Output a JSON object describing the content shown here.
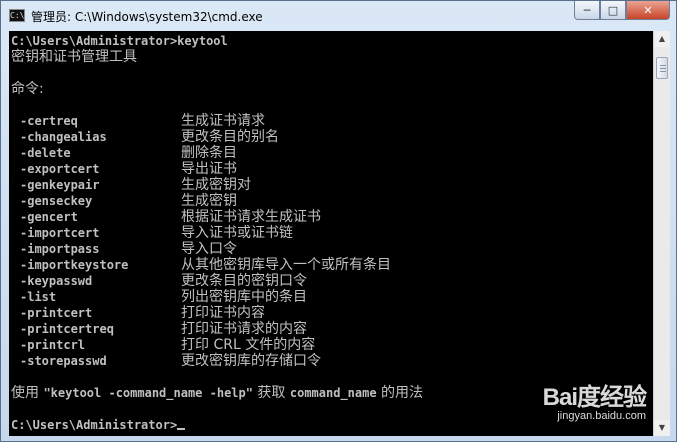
{
  "window": {
    "title": "管理员: C:\\Windows\\system32\\cmd.exe",
    "icon_glyph": "C:\\",
    "buttons": {
      "minimize": "─",
      "maximize": "□",
      "close": "✕"
    }
  },
  "console": {
    "prompt_command": "C:\\Users\\Administrator>keytool",
    "tool_description": "密钥和证书管理工具",
    "commands_header": "命令:",
    "commands": [
      {
        "name": "-certreq",
        "desc": "生成证书请求"
      },
      {
        "name": "-changealias",
        "desc": "更改条目的别名"
      },
      {
        "name": "-delete",
        "desc": "删除条目"
      },
      {
        "name": "-exportcert",
        "desc": "导出证书"
      },
      {
        "name": "-genkeypair",
        "desc": "生成密钥对"
      },
      {
        "name": "-genseckey",
        "desc": "生成密钥"
      },
      {
        "name": "-gencert",
        "desc": "根据证书请求生成证书"
      },
      {
        "name": "-importcert",
        "desc": "导入证书或证书链"
      },
      {
        "name": "-importpass",
        "desc": "导入口令"
      },
      {
        "name": "-importkeystore",
        "desc": "从其他密钥库导入一个或所有条目"
      },
      {
        "name": "-keypasswd",
        "desc": "更改条目的密钥口令"
      },
      {
        "name": "-list",
        "desc": "列出密钥库中的条目"
      },
      {
        "name": "-printcert",
        "desc": "打印证书内容"
      },
      {
        "name": "-printcertreq",
        "desc": "打印证书请求的内容"
      },
      {
        "name": "-printcrl",
        "desc": "打印 CRL 文件的内容"
      },
      {
        "name": "-storepasswd",
        "desc": "更改密钥库的存储口令"
      }
    ],
    "usage_prefix": "使用 ",
    "usage_command": "\"keytool -command_name -help\"",
    "usage_middle": " 获取 ",
    "usage_name": "command_name",
    "usage_suffix": " 的用法",
    "final_prompt": "C:\\Users\\Administrator>"
  },
  "scrollbar": {
    "up_arrow": "▲",
    "down_arrow": "▼"
  },
  "watermark": {
    "logo": "Bai度经验",
    "url": "jingyan.baidu.com"
  }
}
